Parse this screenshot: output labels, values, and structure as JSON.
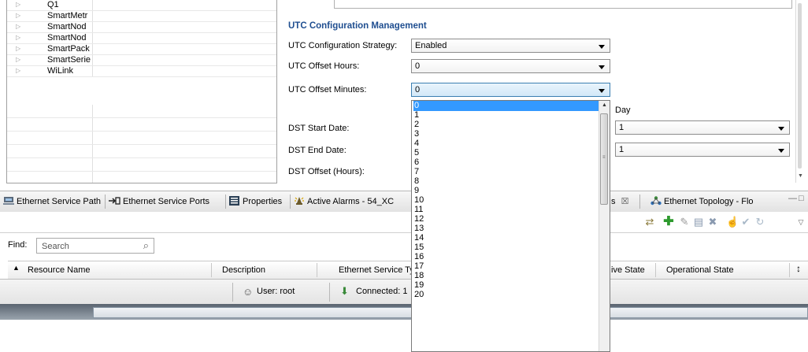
{
  "tree": {
    "items": [
      {
        "label": "Q1"
      },
      {
        "label": "SmartMetr"
      },
      {
        "label": "SmartNod"
      },
      {
        "label": "SmartNod"
      },
      {
        "label": "SmartPack"
      },
      {
        "label": "SmartSerie"
      },
      {
        "label": "WiLink"
      }
    ]
  },
  "config": {
    "section_title": "UTC Configuration Management",
    "fields": [
      {
        "label": "UTC Configuration Strategy:",
        "value": "Enabled"
      },
      {
        "label": "UTC Offset Hours:",
        "value": "0"
      },
      {
        "label": "UTC Offset Minutes:",
        "value": "0"
      }
    ],
    "dst_start_label": "DST Start Date:",
    "dst_end_label": "DST End Date:",
    "dst_offset_label": "DST Offset (Hours):",
    "day_header": "Day",
    "dst_start_day": "1",
    "dst_end_day": "1"
  },
  "dropdown": {
    "options": [
      "0",
      "1",
      "2",
      "3",
      "4",
      "5",
      "6",
      "7",
      "8",
      "9",
      "10",
      "11",
      "12",
      "13",
      "14",
      "15",
      "16",
      "17",
      "18",
      "19",
      "20"
    ],
    "selected": "0"
  },
  "tabs": [
    {
      "label": "Ethernet Service Path",
      "icon": "network-icon"
    },
    {
      "label": "Ethernet Service Ports",
      "icon": "ports-icon"
    },
    {
      "label": "Properties",
      "icon": "properties-icon"
    },
    {
      "label": "Active Alarms - 54_XC",
      "icon": "alarm-icon"
    },
    {
      "label": "s",
      "icon": "close-icon"
    },
    {
      "label": "Ethernet Topology - Flo",
      "icon": "topology-icon"
    }
  ],
  "find": {
    "label": "Find:",
    "placeholder": "Search"
  },
  "table": {
    "columns": [
      "Resource Name",
      "Description",
      "Ethernet Service Typ",
      "ive State",
      "Operational State"
    ]
  },
  "status": {
    "user": "User: root",
    "connected": "Connected: 1"
  },
  "colors": {
    "section_title": "#1f4e90",
    "selection": "#3399ff"
  }
}
